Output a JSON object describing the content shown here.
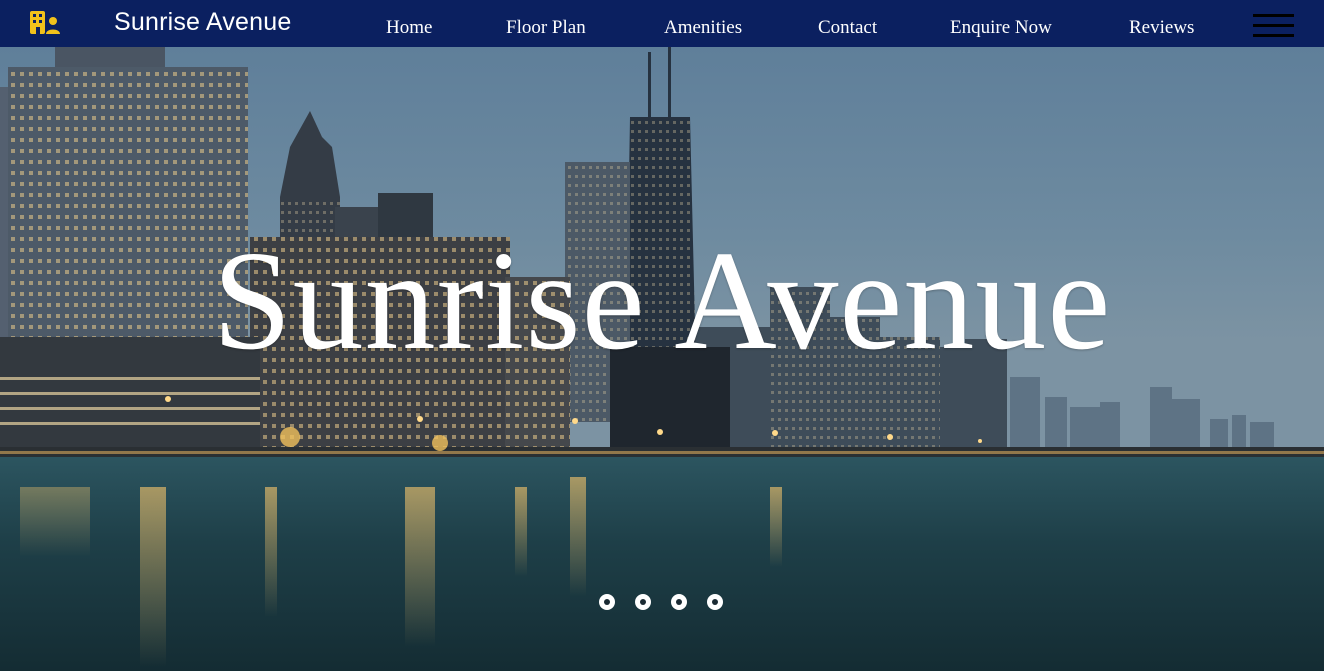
{
  "brand": {
    "name": "Sunrise Avenue",
    "icon": "building-user-icon",
    "icon_color": "#f2c21b"
  },
  "nav": {
    "links": [
      {
        "label": "Home"
      },
      {
        "label": "Floor Plan"
      },
      {
        "label": "Amenities"
      },
      {
        "label": "Contact"
      },
      {
        "label": "Enquire Now"
      },
      {
        "label": "Reviews"
      }
    ],
    "menu_icon": "hamburger-menu-icon",
    "background": "#0b2060"
  },
  "hero": {
    "title": "Sunrise Avenue",
    "background": "city-skyline-waterfront-dusk",
    "slides": 4
  }
}
